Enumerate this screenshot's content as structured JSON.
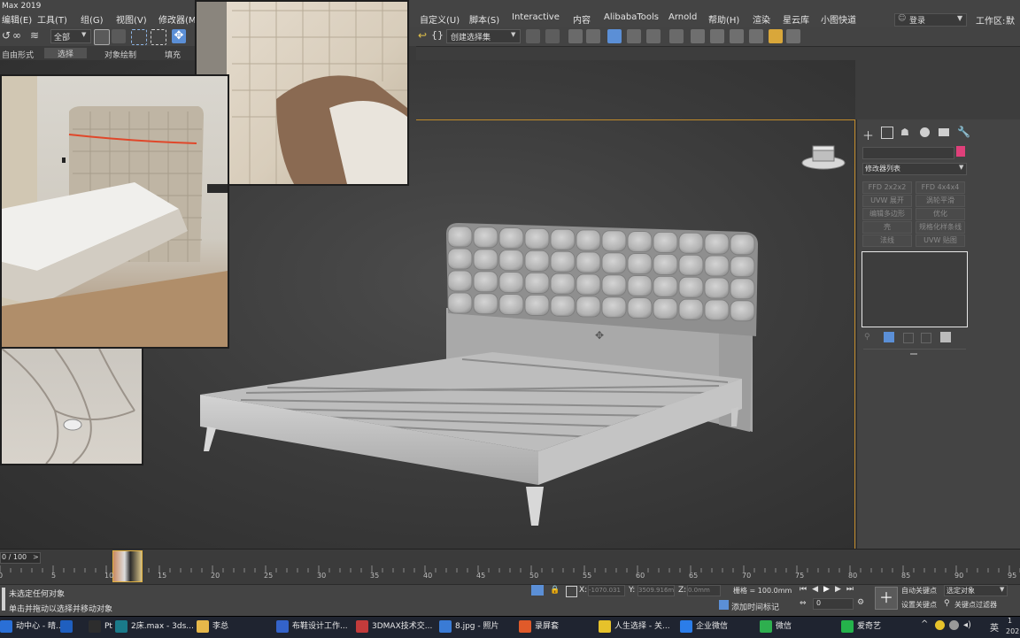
{
  "app": {
    "window_title": "Max 2019",
    "menus_left": [
      "编辑(E)",
      "工具(T)",
      "组(G)",
      "视图(V)",
      "修改器(M)"
    ],
    "menus_right": [
      "自定义(U)",
      "脚本(S)",
      "Interactive",
      "内容",
      "AlibabaTools",
      "Arnold",
      "帮助(H)",
      "渲染",
      "星云库",
      "小图快道"
    ],
    "login_label": "登录",
    "workspace_label": "工作区:",
    "workspace_value": "默认"
  },
  "toolbar": {
    "selection_filter": "全部",
    "named_selection": "创建选择集"
  },
  "ribbon": {
    "tabs": [
      "自由形式",
      "选择",
      "对象绘制",
      "填充"
    ]
  },
  "command_panel": {
    "modifier_list_label": "修改器列表",
    "buttons": [
      [
        "FFD 2x2x2",
        "FFD 4x4x4"
      ],
      [
        "UVW 展开",
        "涡轮平滑"
      ],
      [
        "编辑多边形",
        "优化"
      ],
      [
        "壳",
        "规格化样条线"
      ],
      [
        "法线",
        "UVW 贴图"
      ]
    ],
    "color_swatch": "#e0407a"
  },
  "timeline": {
    "frame_display": "0 / 100",
    "ticks": [
      "0",
      "5",
      "10",
      "15",
      "20",
      "25",
      "30",
      "35",
      "40",
      "45",
      "50",
      "55",
      "60",
      "65",
      "70",
      "75",
      "80",
      "85",
      "90",
      "95"
    ],
    "current_frame": 15
  },
  "status": {
    "line1": "未选定任何对象",
    "line2": "单击并拖动以选择并移动对象",
    "x_label": "X:",
    "x_value": "-1070.031",
    "y_label": "Y:",
    "y_value": "3509.916m",
    "z_label": "Z:",
    "z_value": "0.0mm",
    "grid": "栅格 = 100.0mm",
    "add_time_tag": "添加时间标记",
    "auto_key": "自动关键点",
    "set_key": "设置关键点",
    "selected_object": "选定对象",
    "key_filter": "关键点过滤器",
    "frame_field": "0"
  },
  "taskbar": {
    "items": [
      {
        "label": "动中心 - 晴...",
        "color": "#2a6fd6"
      },
      {
        "label": "",
        "color": "#1f5fbf"
      },
      {
        "label": "Pt",
        "color": "#2d2d2d"
      },
      {
        "label": "2床.max - 3ds...",
        "color": "#1a7a8a"
      },
      {
        "label": "李总",
        "color": "#e6b84a"
      },
      {
        "label": "布鞋设计工作...",
        "color": "#3463c9"
      },
      {
        "label": "3DMAX技术交...",
        "color": "#c23b3b"
      },
      {
        "label": "8.jpg - 照片",
        "color": "#3a7bd5"
      },
      {
        "label": "录屏套",
        "color": "#e05a2a"
      },
      {
        "label": "人生选择 - 关...",
        "color": "#e6c22b"
      },
      {
        "label": "企业微信",
        "color": "#2b7de9"
      },
      {
        "label": "微信",
        "color": "#2eaf4f"
      },
      {
        "label": "爱奇艺",
        "color": "#25b34b"
      }
    ],
    "tray_ime": "英",
    "tray_time": "1",
    "tray_year": "202"
  },
  "colors": {
    "accent_frame": "#c08a2a",
    "viewport_bg": "#3d3d3d",
    "headboard": "#b9b9b9"
  }
}
